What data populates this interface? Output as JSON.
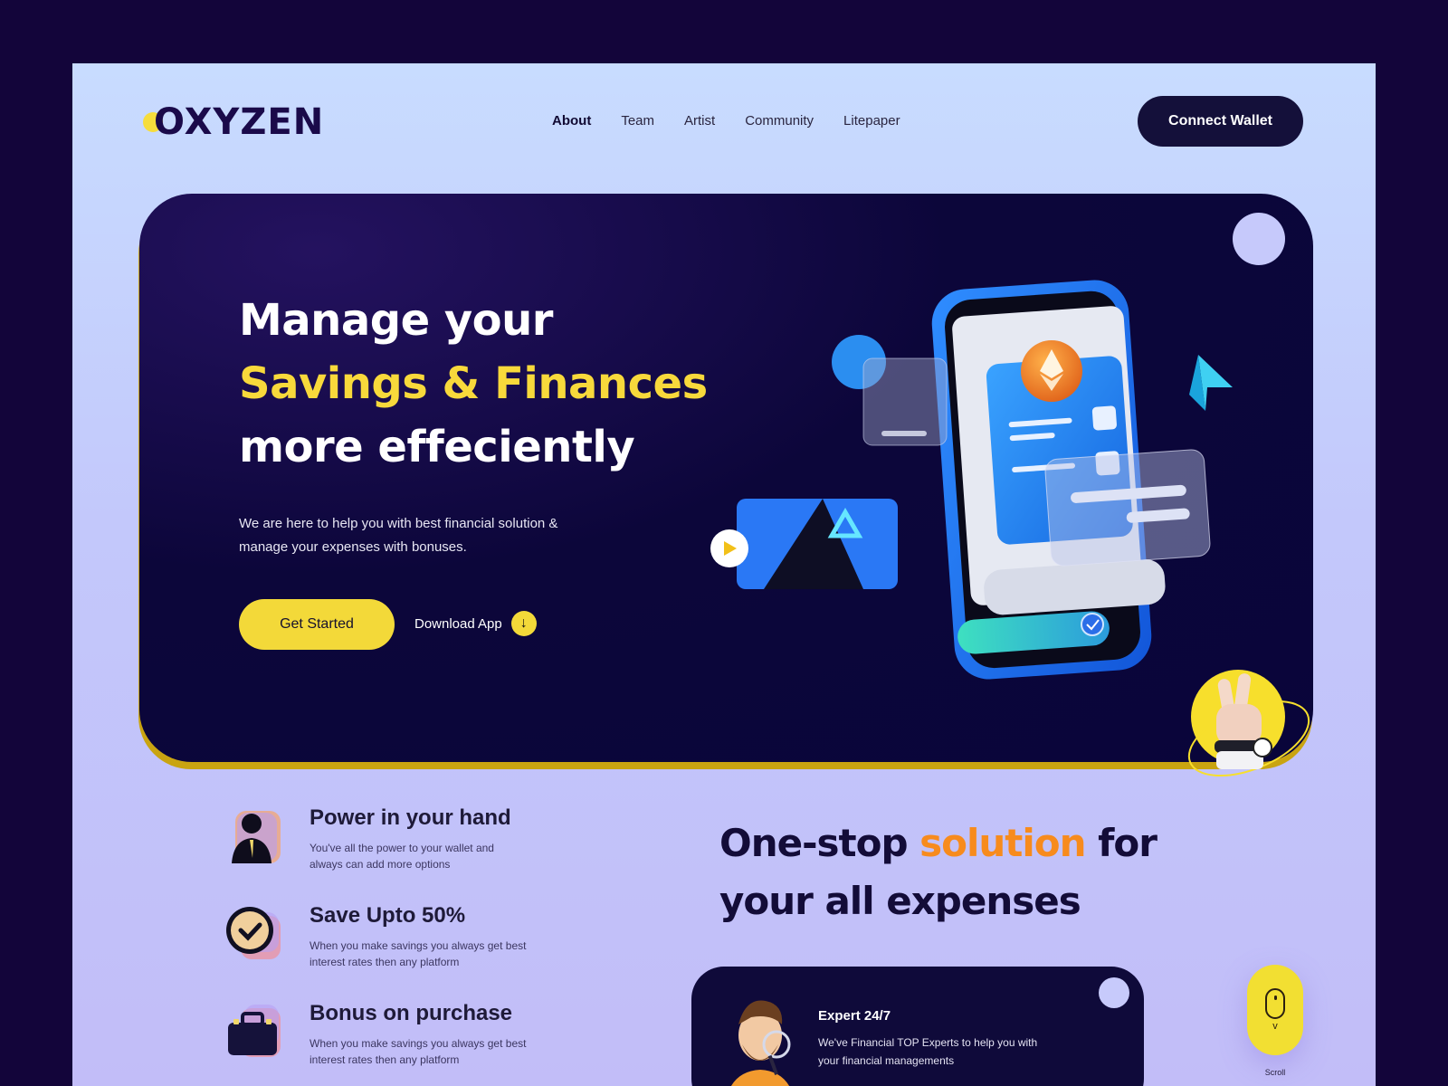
{
  "brand": {
    "name": "OXYZEN",
    "accent": "#f6dd3c",
    "dark": "#14103a"
  },
  "nav": {
    "items": [
      "About",
      "Team",
      "Artist",
      "Community",
      "Litepaper"
    ],
    "active": "About"
  },
  "header": {
    "connect_label": "Connect Wallet"
  },
  "hero": {
    "line1": "Manage your",
    "line2": "Savings & Finances",
    "line3": "more effeciently",
    "subtitle": "We are here to help you with best financial solution & manage your expenses with bonuses.",
    "cta_primary": "Get Started",
    "cta_secondary": "Download App"
  },
  "features": [
    {
      "icon": "person-icon",
      "title": "Power in your hand",
      "desc": "You've all the power to your wallet and always can add more options"
    },
    {
      "icon": "check-circle-icon",
      "title": "Save Upto 50%",
      "desc": "When you make savings you always get best interest rates then any platform"
    },
    {
      "icon": "briefcase-icon",
      "title": "Bonus on purchase",
      "desc": "When you make savings you always get best interest rates then any platform"
    }
  ],
  "onestop": {
    "part1": "One-stop ",
    "highlight": "solution",
    "part2": " for",
    "line2": "your all expenses"
  },
  "expert": {
    "title": "Expert 24/7",
    "desc": "We've Financial  TOP Experts  to help you with your financial managements"
  },
  "scroll": {
    "label": "Scroll"
  }
}
